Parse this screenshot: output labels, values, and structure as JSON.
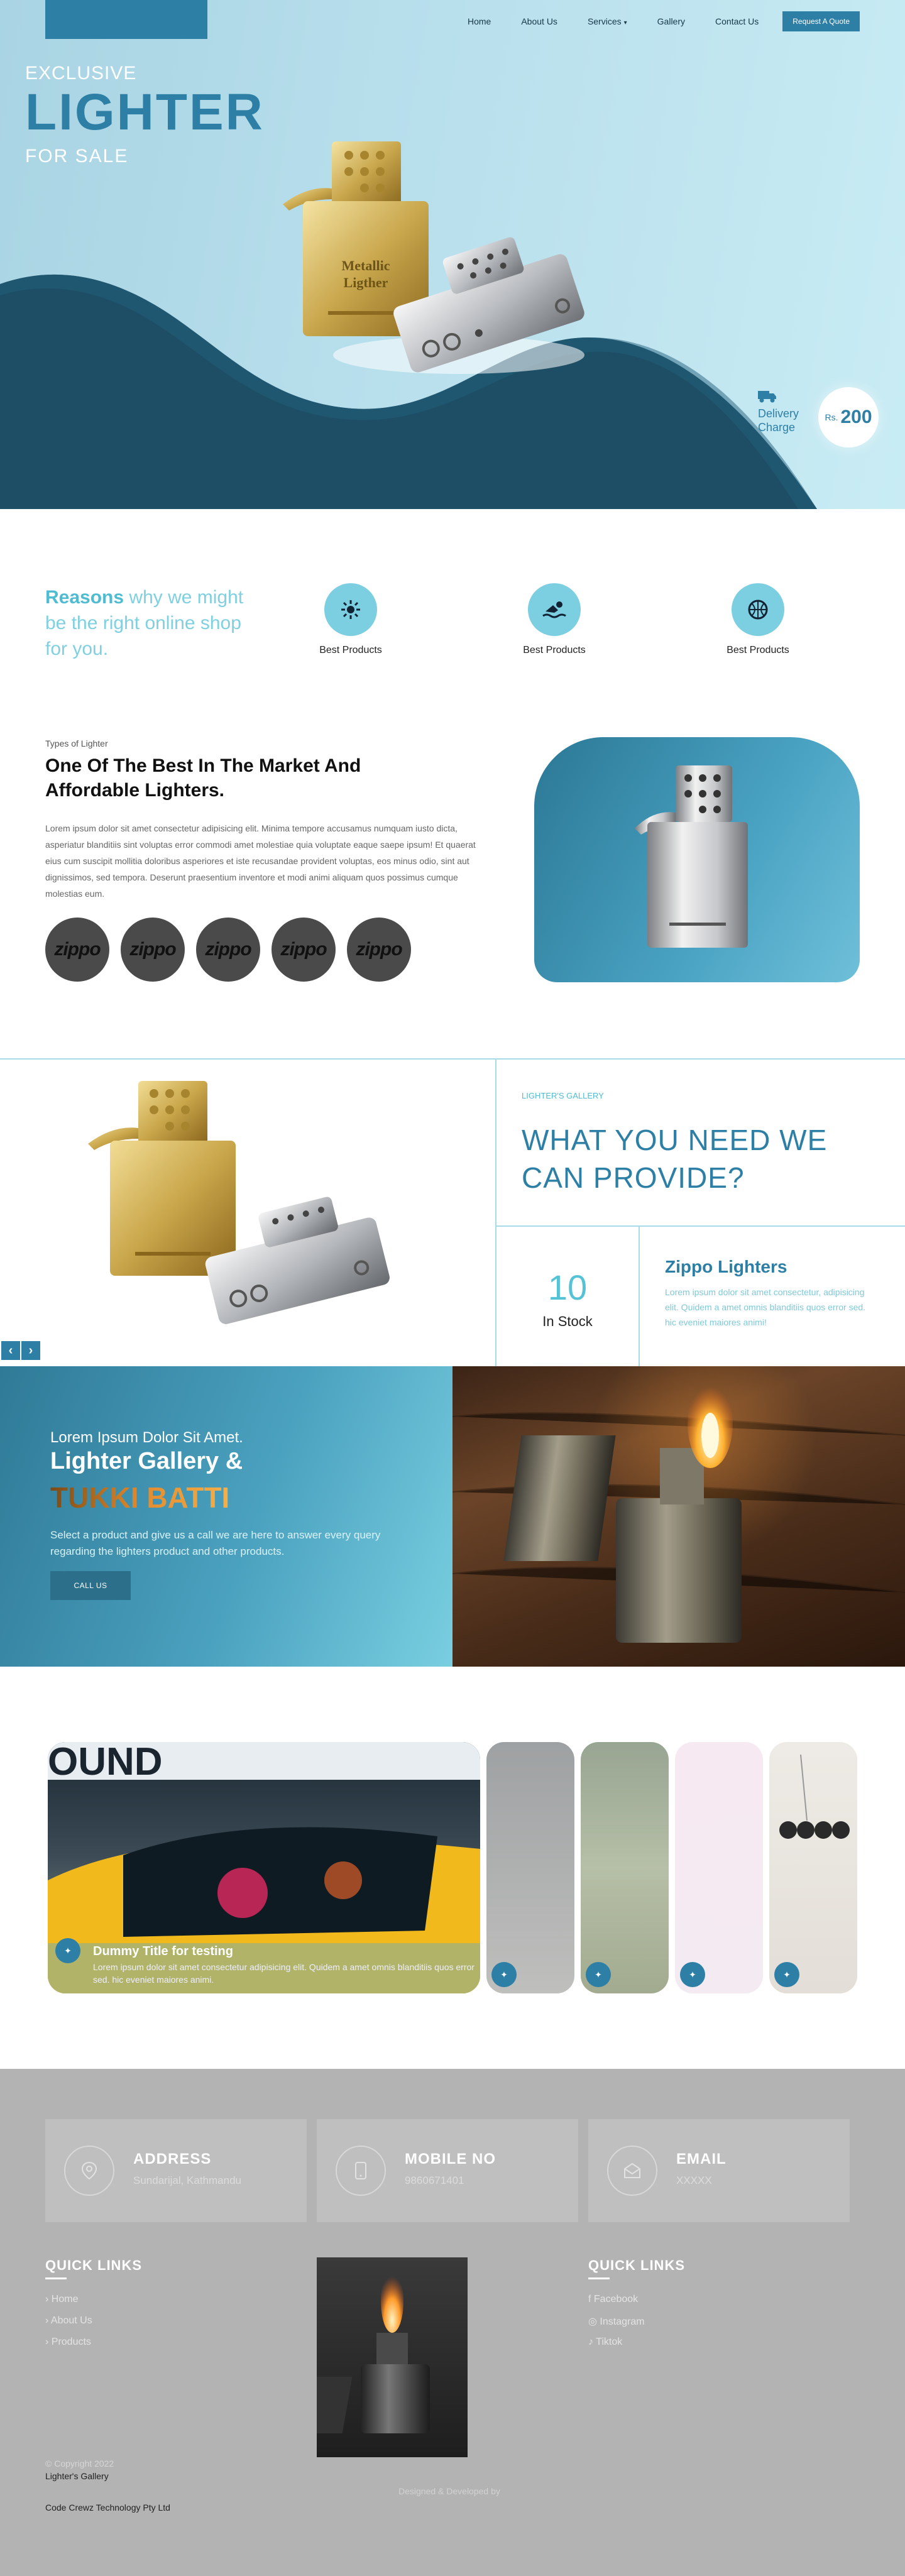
{
  "nav": {
    "items": [
      "Home",
      "About Us",
      "Services",
      "Gallery",
      "Contact Us"
    ],
    "quote_button": "Request A Quote"
  },
  "hero": {
    "pre_title": "EXCLUSIVE",
    "title": "LIGHTER",
    "post_title": "FOR  SALE",
    "product_label_1": "Metallic",
    "product_label_2": "Ligther",
    "delivery_label": "Delivery Charge",
    "delivery_currency": "Rs.",
    "delivery_amount": "200"
  },
  "reasons": {
    "title_bold": "Reasons",
    "title_rest": " why we might be the right online shop for you.",
    "features": [
      {
        "label": "Best Products",
        "icon": "sun-icon"
      },
      {
        "label": "Best Products",
        "icon": "swimmer-icon"
      },
      {
        "label": "Best Products",
        "icon": "basketball-icon"
      }
    ]
  },
  "types": {
    "small": "Types of Lighter",
    "heading": "One Of The Best In The Market And Affordable Lighters.",
    "body": "Lorem ipsum dolor sit amet consectetur adipisicing elit. Minima tempore accusamus numquam iusto dicta, asperiatur blanditiis sint voluptas error commodi amet molestiae quia voluptate eaque saepe ipsum! Et quaerat eius cum suscipit mollitia doloribus asperiores et iste recusandae provident voluptas, eos minus odio, sint aut dignissimos, sed tempora. Deserunt praesentium inventore et modi animi aliquam quos possimus cumque molestias eum.",
    "brands": [
      "zippo",
      "zippo",
      "zippo",
      "zippo",
      "zippo"
    ]
  },
  "provide": {
    "small": "LIGHTER'S GALLERY",
    "heading": "WHAT YOU NEED WE CAN PROVIDE?",
    "stock_number": "10",
    "stock_label": "In Stock",
    "product_title": "Zippo Lighters",
    "product_body": "Lorem ipsum dolor sit amet consectetur, adipisicing elit. Quidem a amet omnis blanditiis quos error sed. hic eveniet maiores animi!",
    "prev_arrow": "‹",
    "next_arrow": "›"
  },
  "cta": {
    "pre": "Lorem Ipsum Dolor Sit Amet.",
    "title": "Lighter Gallery &",
    "subtitle": "TUKKI BATTI",
    "body": "Select a product and give us a call we are here to answer every query regarding the lighters product and other products.",
    "button": "CALL US"
  },
  "slider": {
    "active_title": "Dummy Title for testing",
    "active_body": "Lorem ipsum dolor sit amet consectetur adipisicing elit. Quidem a amet omnis blanditiis quos error sed. hic eveniet maiores animi.",
    "sign_text": "OUND"
  },
  "footer": {
    "contacts": [
      {
        "title": "ADDRESS",
        "value": "Sundarijal, Kathmandu",
        "icon": "map-pin-icon"
      },
      {
        "title": "MOBILE NO",
        "value": "9860671401",
        "icon": "mobile-icon"
      },
      {
        "title": "EMAIL",
        "value": "XXXXX",
        "icon": "envelope-icon"
      }
    ],
    "quick_links_left": {
      "title": "QUICK LINKS",
      "items": [
        "Home",
        "About Us",
        "Products"
      ]
    },
    "quick_links_right": {
      "title": "QUICK LINKS",
      "items": [
        "Facebook",
        "Instagram",
        "Tiktok"
      ]
    },
    "copyright": "© Copyright 2022",
    "company": "Lighter's Gallery",
    "designed_by": "Designed & Developed by",
    "developer": "Code Crewz Technology Pty Ltd"
  }
}
